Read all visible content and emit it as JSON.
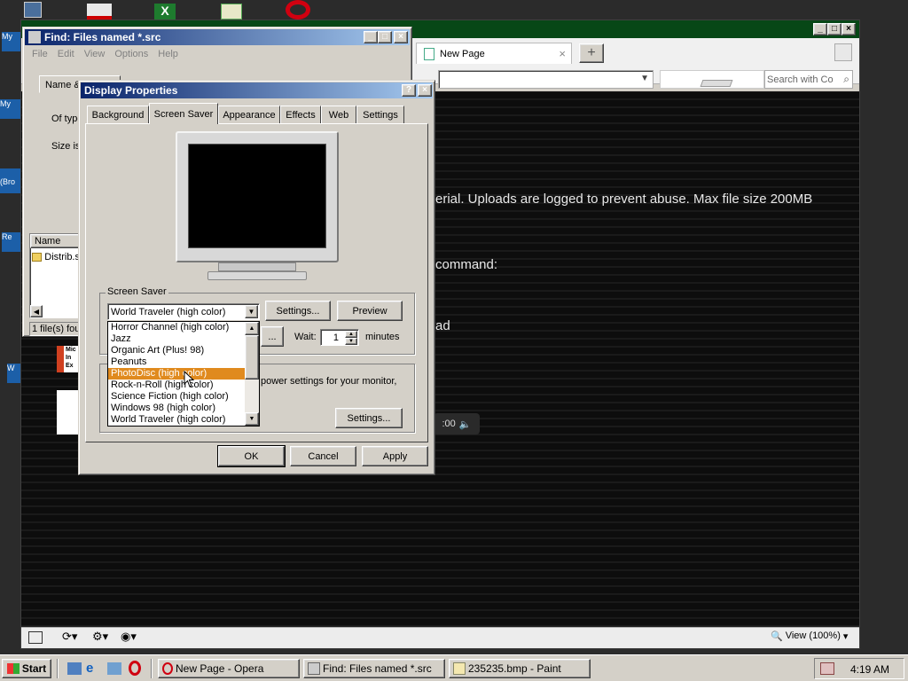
{
  "desktop": {
    "icons": [
      "My",
      "My",
      "(Bro",
      "Re",
      "W"
    ]
  },
  "opera": {
    "title": "",
    "tab_label": "New Page",
    "search_placeholder": "Search with Co",
    "content_lines": [
      "erial. Uploads are logged to prevent abuse. Max file size 200MB",
      "command:",
      "ad"
    ],
    "video_time": ":00",
    "zoom_label": "View (100%)"
  },
  "find": {
    "title": "Find: Files named *.src",
    "menu": [
      "File",
      "Edit",
      "View",
      "Options",
      "Help"
    ],
    "tab_label": "Name &",
    "of_type_label": "Of type",
    "size_label": "Size is",
    "column_name": "Name",
    "file_name": "Distrib.s",
    "status": "1 file(s) foun",
    "ie_logo_text": [
      "Mic",
      "In",
      "Ex"
    ]
  },
  "display": {
    "title": "Display Properties",
    "tabs": [
      "Background",
      "Screen Saver",
      "Appearance",
      "Effects",
      "Web",
      "Settings"
    ],
    "active_tab": "Screen Saver",
    "group_label": "Screen Saver",
    "selected_saver": "World Traveler (high color)",
    "settings_label": "Settings...",
    "preview_label": "Preview",
    "password_btn_label": "...",
    "wait_label": "Wait:",
    "wait_value": "1",
    "minutes_label": "minutes",
    "energy_text": "power settings for your monitor,",
    "energy_settings_label": "Settings...",
    "dropdown_items": [
      "Horror Channel (high color)",
      "Jazz",
      "Organic Art (Plus! 98)",
      "Peanuts",
      "PhotoDisc (high color)",
      "Rock-n-Roll (high color)",
      "Science Fiction (high color)",
      "Windows 98 (high color)",
      "World Traveler (high color)"
    ],
    "highlighted_item": "PhotoDisc (high color)",
    "ok_label": "OK",
    "cancel_label": "Cancel",
    "apply_label": "Apply"
  },
  "taskbar": {
    "start_label": "Start",
    "tasks": [
      "New Page - Opera",
      "Find: Files named *.src",
      "235235.bmp - Paint"
    ],
    "clock": "4:19 AM"
  },
  "colors": {
    "active_caption": "#0a246a",
    "opera_caption": "#074716",
    "highlight": "#e08a1e",
    "face": "#d4d0c8"
  }
}
